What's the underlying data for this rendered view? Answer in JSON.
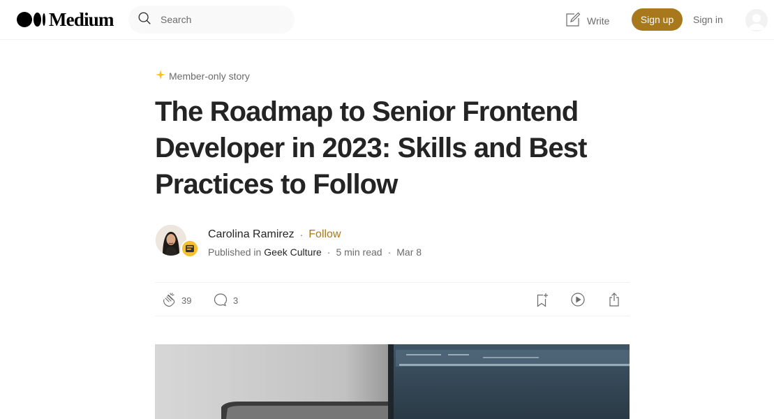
{
  "app": {
    "logo_text": "Medium"
  },
  "header": {
    "search_placeholder": "Search",
    "write_label": "Write",
    "signup_label": "Sign up",
    "signin_label": "Sign in"
  },
  "article": {
    "badge": "Member-only story",
    "title": "The Roadmap to Senior Frontend Developer in 2023: Skills and Best Practices to Follow",
    "author_name": "Carolina Ramirez",
    "follow_label": "Follow",
    "published_in_label": "Published in",
    "publication": "Geek Culture",
    "read_time": "5 min read",
    "date": "Mar 8",
    "claps": "39",
    "responses": "3"
  },
  "colors": {
    "accent": "#a8781d",
    "text": "#242424",
    "muted": "#6b6b6b",
    "star": "#ffc017"
  }
}
